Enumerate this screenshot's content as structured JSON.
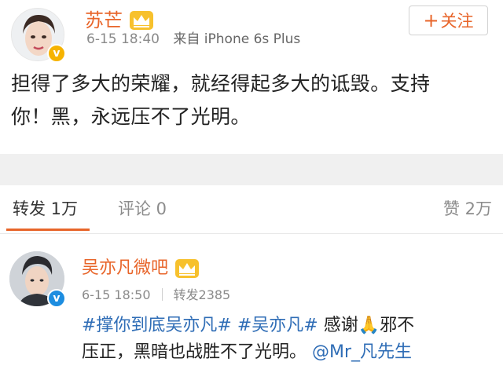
{
  "post": {
    "author": "苏芒",
    "time": "6-15 18:40",
    "source": "来自 iPhone 6s Plus",
    "follow_plus": "+",
    "follow_label": "关注",
    "text_line1": "担得了多大的荣耀，就经得起多大的诋毁。支持",
    "text_line2": "你！黑，永远压不了光明。",
    "verified_mark": "v"
  },
  "tabs": {
    "repost": "转发 1万",
    "comment": "评论 0",
    "like": "赞 2万"
  },
  "repost_item": {
    "author": "吴亦凡微吧",
    "time": "6-15 18:50",
    "repost_count": "转发2385",
    "verified_mark": "v",
    "hashtag1": "#撑你到底吴亦凡#",
    "hashtag2": "#吴亦凡#",
    "text_thanks": "感谢",
    "pray_icon": "🙏",
    "text_line1_end": "邪不",
    "text_line2": "压正，黑暗也战胜不了光明。",
    "mention": "@Mr_凡先生"
  },
  "colors": {
    "accent": "#e8652a",
    "link": "#2f6db6",
    "gold_badge": "#f6b300",
    "blue_badge": "#1d8de0"
  },
  "icons": {
    "crown": "crown-icon",
    "verified": "verified-badge-icon"
  }
}
